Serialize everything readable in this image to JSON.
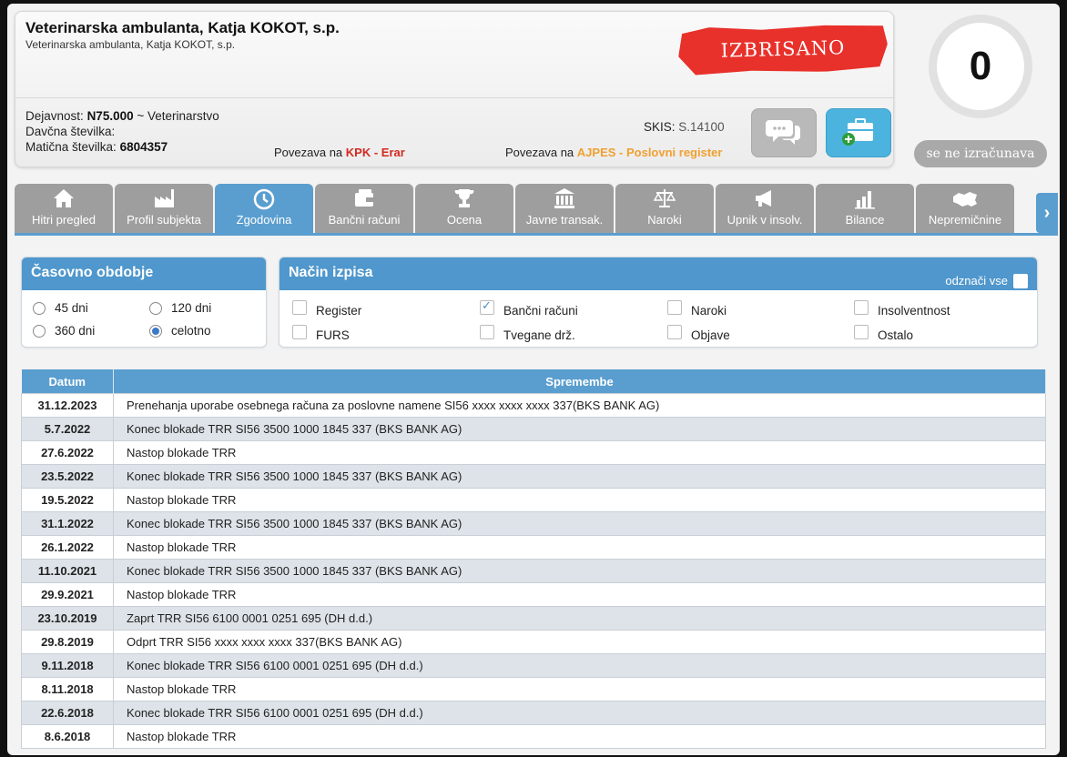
{
  "company": {
    "name": "Veterinarska ambulanta, Katja KOKOT, s.p.",
    "subname": "Veterinarska ambulanta, Katja KOKOT, s.p.",
    "stamp": "IZBRISANO",
    "dejavnost_label": "Dejavnost:",
    "dejavnost_code": "N75.000",
    "dejavnost_text": "~ Veterinarstvo",
    "davcna_label": "Davčna številka:",
    "davcna_value": "",
    "maticna_label": "Matična številka:",
    "maticna_value": "6804357",
    "kpk_prefix": "Povezava na",
    "kpk_link": "KPK - Erar",
    "ajpes_prefix": "Povezava na",
    "ajpes_link": "AJPES - Poslovni register",
    "skis_label": "SKIS:",
    "skis_value": "S.14100"
  },
  "score": {
    "value": "0",
    "status": "se ne izračunava"
  },
  "tabs": [
    {
      "label": "Hitri pregled",
      "icon": "home-icon"
    },
    {
      "label": "Profil subjekta",
      "icon": "factory-icon"
    },
    {
      "label": "Zgodovina",
      "icon": "history-icon"
    },
    {
      "label": "Bančni računi",
      "icon": "wallet-icon"
    },
    {
      "label": "Ocena",
      "icon": "trophy-icon"
    },
    {
      "label": "Javne transak.",
      "icon": "building-icon"
    },
    {
      "label": "Naroki",
      "icon": "scales-icon"
    },
    {
      "label": "Upnik v insolv.",
      "icon": "megaphone-icon"
    },
    {
      "label": "Bilance",
      "icon": "bar-chart-icon"
    },
    {
      "label": "Nepremičnine",
      "icon": "map-icon"
    }
  ],
  "active_tab": "Zgodovina",
  "period": {
    "title": "Časovno obdobje",
    "options": [
      "45 dni",
      "120 dni",
      "360 dni",
      "celotno"
    ],
    "selected": "celotno"
  },
  "mode": {
    "title": "Način izpisa",
    "unselect_all": "odznači vse",
    "options": [
      {
        "label": "Register",
        "checked": false
      },
      {
        "label": "Bančni računi",
        "checked": true
      },
      {
        "label": "Naroki",
        "checked": false
      },
      {
        "label": "Insolventnost",
        "checked": false
      },
      {
        "label": "FURS",
        "checked": false
      },
      {
        "label": "Tvegane drž.",
        "checked": false
      },
      {
        "label": "Objave",
        "checked": false
      },
      {
        "label": "Ostalo",
        "checked": false
      }
    ]
  },
  "table": {
    "headers": [
      "Datum",
      "Spremembe"
    ],
    "rows": [
      {
        "date": "31.12.2023",
        "text": "Prenehanja uporabe osebnega računa za poslovne namene SI56 xxxx xxxx xxxx 337(BKS BANK AG)"
      },
      {
        "date": "5.7.2022",
        "text": "Konec blokade TRR SI56 3500 1000 1845 337 (BKS BANK AG)"
      },
      {
        "date": "27.6.2022",
        "text": "Nastop blokade TRR"
      },
      {
        "date": "23.5.2022",
        "text": "Konec blokade TRR SI56 3500 1000 1845 337 (BKS BANK AG)"
      },
      {
        "date": "19.5.2022",
        "text": "Nastop blokade TRR"
      },
      {
        "date": "31.1.2022",
        "text": "Konec blokade TRR SI56 3500 1000 1845 337 (BKS BANK AG)"
      },
      {
        "date": "26.1.2022",
        "text": "Nastop blokade TRR"
      },
      {
        "date": "11.10.2021",
        "text": "Konec blokade TRR SI56 3500 1000 1845 337 (BKS BANK AG)"
      },
      {
        "date": "29.9.2021",
        "text": "Nastop blokade TRR"
      },
      {
        "date": "23.10.2019",
        "text": "Zaprt TRR SI56 6100 0001 0251 695 (DH d.d.)"
      },
      {
        "date": "29.8.2019",
        "text": "Odprt TRR SI56 xxxx xxxx xxxx 337(BKS BANK AG)"
      },
      {
        "date": "9.11.2018",
        "text": "Konec blokade TRR SI56 6100 0001 0251 695 (DH d.d.)"
      },
      {
        "date": "8.11.2018",
        "text": "Nastop blokade TRR"
      },
      {
        "date": "22.6.2018",
        "text": "Konec blokade TRR SI56 6100 0001 0251 695 (DH d.d.)"
      },
      {
        "date": "8.6.2018",
        "text": "Nastop blokade TRR"
      }
    ]
  },
  "colors": {
    "accent": "#5a9ecf",
    "stamp": "#e8312a",
    "tab_inactive": "#9e9e9e",
    "link_red": "#d4291f",
    "link_orange": "#f0a030"
  }
}
